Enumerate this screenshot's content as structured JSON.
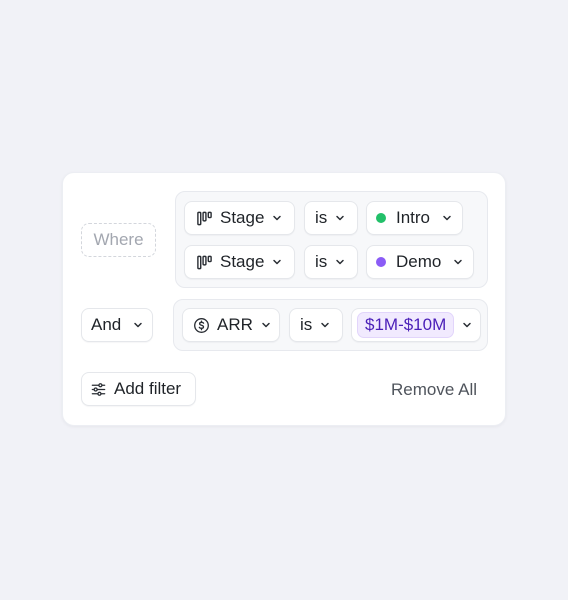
{
  "filters": {
    "where_label": "Where",
    "and_label": "And",
    "group1": {
      "rows": [
        {
          "field": "Stage",
          "field_icon": "kanban-icon",
          "operator": "is",
          "value": "Intro",
          "value_color": "#22c069"
        },
        {
          "field": "Stage",
          "field_icon": "kanban-icon",
          "operator": "is",
          "value": "Demo",
          "value_color": "#8b5cf6"
        }
      ]
    },
    "group2": {
      "field": "ARR",
      "field_icon": "dollar-circle-icon",
      "operator": "is",
      "value": "$1M-$10M",
      "value_tag_color": "#f1eafe"
    }
  },
  "footer": {
    "add_filter_label": "Add filter",
    "add_filter_icon": "sliders-icon",
    "remove_all_label": "Remove All"
  }
}
